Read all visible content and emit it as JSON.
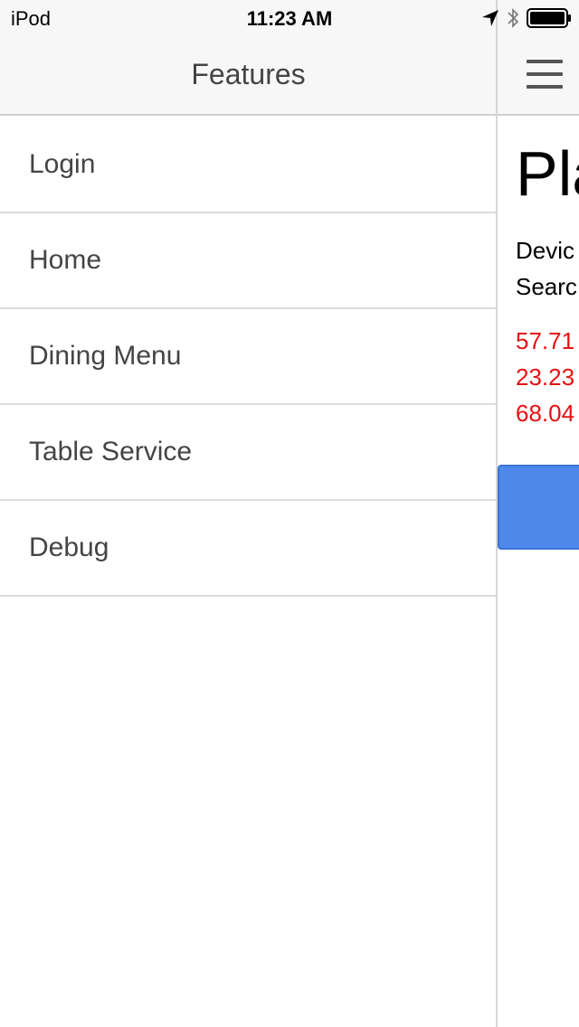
{
  "status_bar": {
    "carrier": "iPod",
    "time": "11:23 AM",
    "icons": [
      "location-arrow-icon",
      "bluetooth-icon",
      "battery-icon"
    ]
  },
  "drawer": {
    "title": "Features",
    "items": [
      {
        "label": "Login"
      },
      {
        "label": "Home"
      },
      {
        "label": "Dining Menu"
      },
      {
        "label": "Table Service"
      },
      {
        "label": "Debug"
      }
    ]
  },
  "main": {
    "menu_icon": "hamburger-icon",
    "title": "Pla",
    "info_lines": [
      "Devic",
      "Searc"
    ],
    "coordinates": [
      "57.71",
      "23.23",
      "68.04"
    ],
    "coordinate_color": "#e81010",
    "button_color": "#4d88ea"
  }
}
